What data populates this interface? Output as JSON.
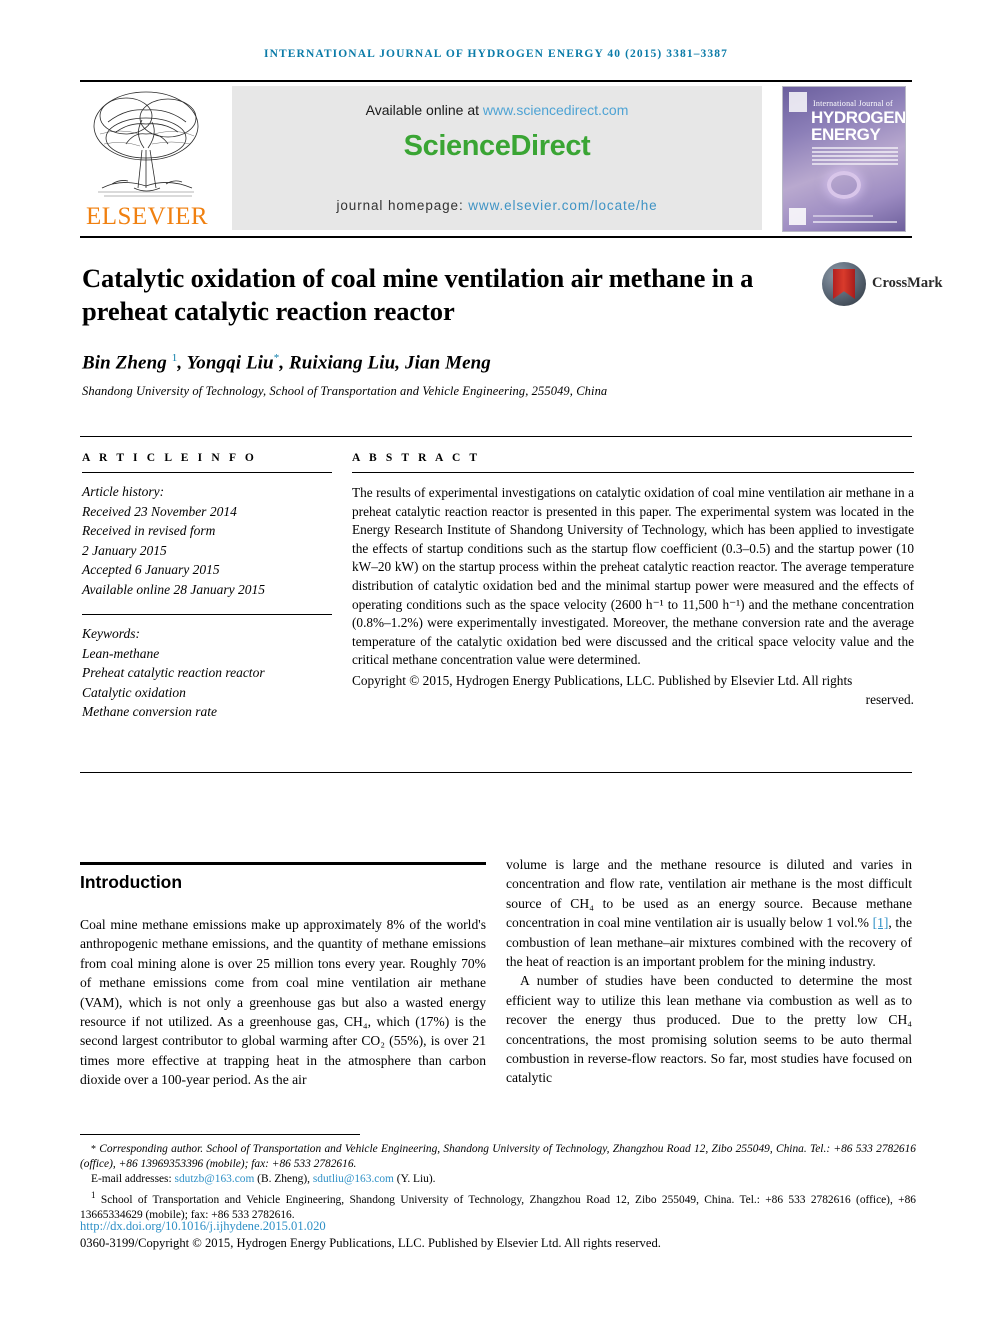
{
  "running_head": "INTERNATIONAL JOURNAL OF HYDROGEN ENERGY 40 (2015) 3381–3387",
  "masthead": {
    "publisher": "ELSEVIER",
    "available_text": "Available online at",
    "available_link": "www.sciencedirect.com",
    "sciencedirect_logo": "ScienceDirect",
    "homepage_label": "journal homepage:",
    "homepage_link": "www.elsevier.com/locate/he",
    "cover": {
      "line1": "International Journal of",
      "line2": "HYDROGEN",
      "line3": "ENERGY"
    },
    "colors": {
      "elsevier_orange": "#f08010",
      "sciencedirect_green": "#3aa534",
      "link_blue": "#3f93c4",
      "running_head_blue": "#0b7ba8",
      "panel_grey": "#e7e7e7"
    }
  },
  "crossmark": {
    "label": "CrossMark"
  },
  "article": {
    "title": "Catalytic oxidation of coal mine ventilation air methane in a preheat catalytic reaction reactor",
    "authors_html": "Bin Zheng <sup>1</sup>, Yongqi Liu<sup class=\"star\">*</sup>, Ruixiang Liu, Jian Meng",
    "affiliation": "Shandong University of Technology, School of Transportation and Vehicle Engineering, 255049, China"
  },
  "article_info": {
    "heading": "A R T I C L E   I N F O",
    "history_label": "Article history:",
    "history": [
      "Received 23 November 2014",
      "Received in revised form",
      "2 January 2015",
      "Accepted 6 January 2015",
      "Available online 28 January 2015"
    ],
    "keywords_label": "Keywords:",
    "keywords": [
      "Lean-methane",
      "Preheat catalytic reaction reactor",
      "Catalytic oxidation",
      "Methane conversion rate"
    ]
  },
  "abstract": {
    "heading": "A B S T R A C T",
    "text": "The results of experimental investigations on catalytic oxidation of coal mine ventilation air methane in a preheat catalytic reaction reactor is presented in this paper. The experimental system was located in the Energy Research Institute of Shandong University of Technology, which has been applied to investigate the effects of startup conditions such as the startup flow coefficient (0.3–0.5) and the startup power (10 kW–20 kW) on the startup process within the preheat catalytic reaction reactor. The average temperature distribution of catalytic oxidation bed and the minimal startup power were measured and the effects of operating conditions such as the space velocity (2600 h⁻¹ to 11,500 h⁻¹) and the methane concentration (0.8%–1.2%) were experimentally investigated. Moreover, the methane conversion rate and the average temperature of the catalytic oxidation bed were discussed and the critical space velocity value and the critical methane concentration value were determined.",
    "copyright": "Copyright © 2015, Hydrogen Energy Publications, LLC. Published by Elsevier Ltd. All rights",
    "copyright_last": "reserved."
  },
  "body": {
    "intro_heading": "Introduction",
    "left_column": "Coal mine methane emissions make up approximately 8% of the world's anthropogenic methane emissions, and the quantity of methane emissions from coal mining alone is over 25 million tons every year. Roughly 70% of methane emissions come from coal mine ventilation air methane (VAM), which is not only a greenhouse gas but also a wasted energy resource if not utilized. As a greenhouse gas, CH₄, which (17%) is the second largest contributor to global warming after CO₂ (55%), is over 21 times more effective at trapping heat in the atmosphere than carbon dioxide over a 100-year period. As the air",
    "right_paragraph_1_pre": "volume is large and the methane resource is diluted and varies in concentration and flow rate, ventilation air methane is the most difficult source of CH₄ to be used as an energy source. Because methane concentration in coal mine ventilation air is usually below 1 vol.% ",
    "right_paragraph_1_ref": "[1]",
    "right_paragraph_1_post": ", the combustion of lean methane–air mixtures combined with the recovery of the heat of reaction is an important problem for the mining industry.",
    "right_paragraph_2": "A number of studies have been conducted to determine the most efficient way to utilize this lean methane via combustion as well as to recover the energy thus produced. Due to the pretty low CH₄ concentrations, the most promising solution seems to be auto thermal combustion in reverse-flow reactors. So far, most studies have focused on catalytic"
  },
  "footnotes": {
    "corresponding": "Corresponding author. School of Transportation and Vehicle Engineering, Shandong University of Technology, Zhangzhou Road 12, Zibo 255049, China. Tel.: +86 533 2782616 (office), +86 13969353396 (mobile); fax: +86 533 2782616.",
    "email_label": "E-mail addresses:",
    "email_1": "sdutzb@163.com",
    "email_1_name": "(B. Zheng),",
    "email_2": "sdutliu@163.com",
    "email_2_name": "(Y. Liu).",
    "note_1": "School of Transportation and Vehicle Engineering, Shandong University of Technology, Zhangzhou Road 12, Zibo 255049, China. Tel.: +86 533 2782616 (office), +86 13665334629 (mobile); fax: +86 533 2782616.",
    "doi": "http://dx.doi.org/10.1016/j.ijhydene.2015.01.020",
    "issn_line": "0360-3199/Copyright © 2015, Hydrogen Energy Publications, LLC. Published by Elsevier Ltd. All rights reserved."
  }
}
